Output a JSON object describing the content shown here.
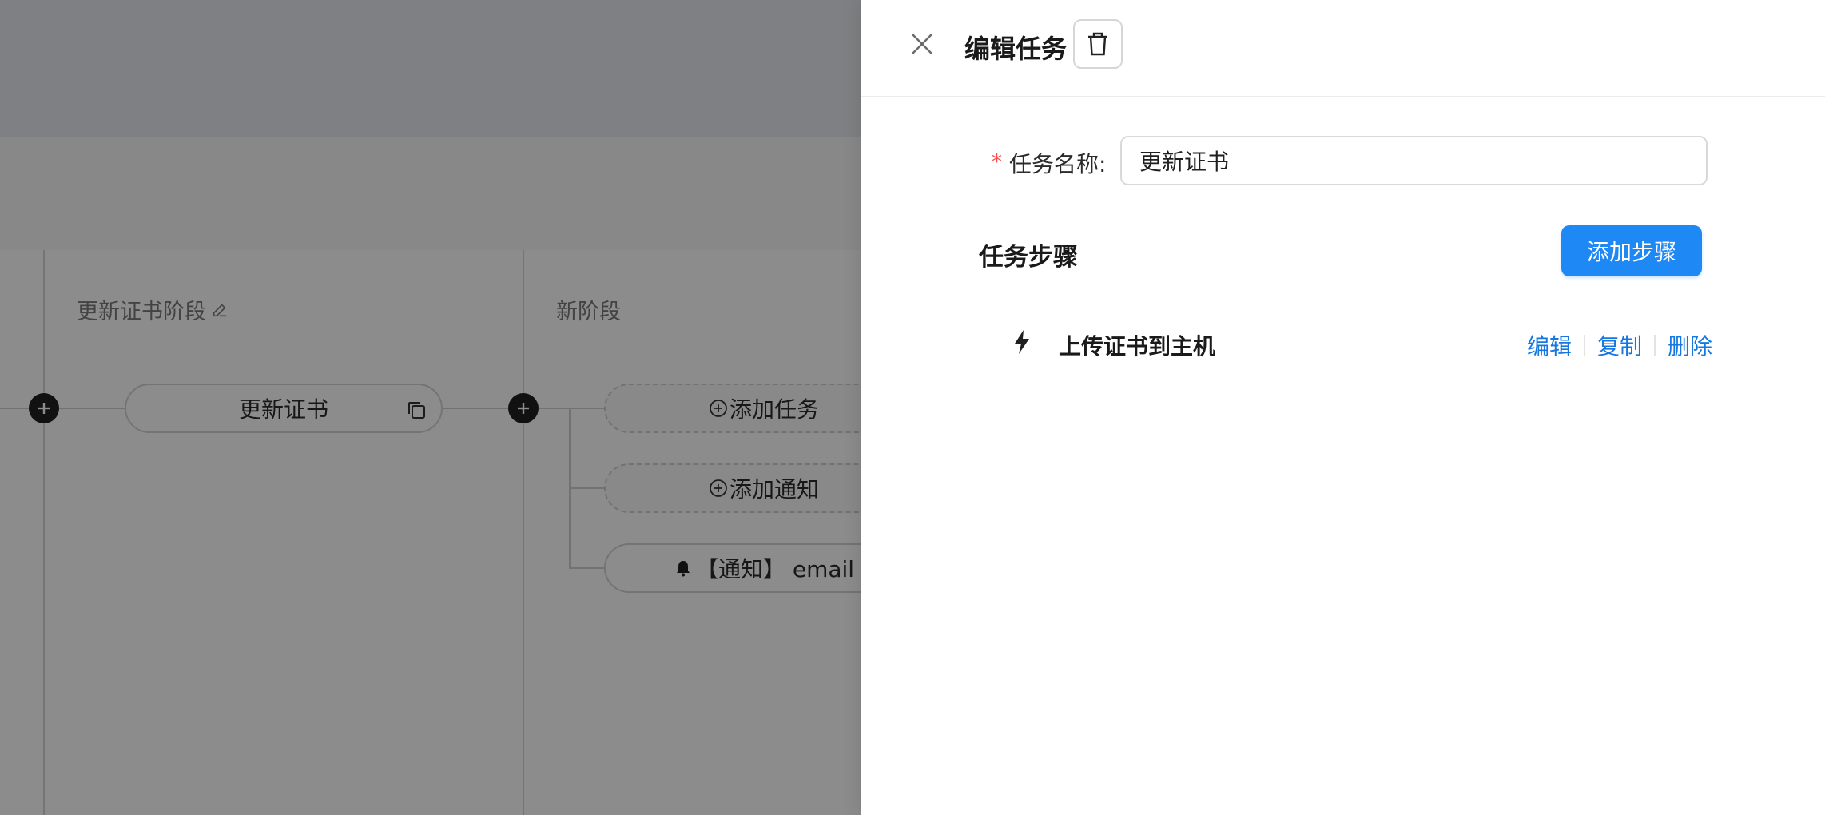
{
  "background": {
    "stages": [
      {
        "title": "更新证书阶段",
        "tasks": [
          {
            "label": "更新证书"
          }
        ]
      },
      {
        "title": "新阶段",
        "tasks": [
          {
            "label": "添加任务"
          },
          {
            "label": "添加通知"
          },
          {
            "label": "【通知】 email"
          }
        ]
      }
    ]
  },
  "drawer": {
    "title": "编辑任务",
    "form": {
      "required_mark": "*",
      "name_label": "任务名称:",
      "name_value": "更新证书"
    },
    "steps_section": {
      "title": "任务步骤",
      "add_button": "添加步骤",
      "steps": [
        {
          "icon": "lightning-icon",
          "name": "上传证书到主机",
          "actions": [
            "编辑",
            "复制",
            "删除"
          ]
        }
      ]
    }
  },
  "colors": {
    "primary": "#1e88f5",
    "link": "#1677e0",
    "required": "#ff4d4f",
    "overlay": "rgba(0,0,0,0.45)"
  }
}
